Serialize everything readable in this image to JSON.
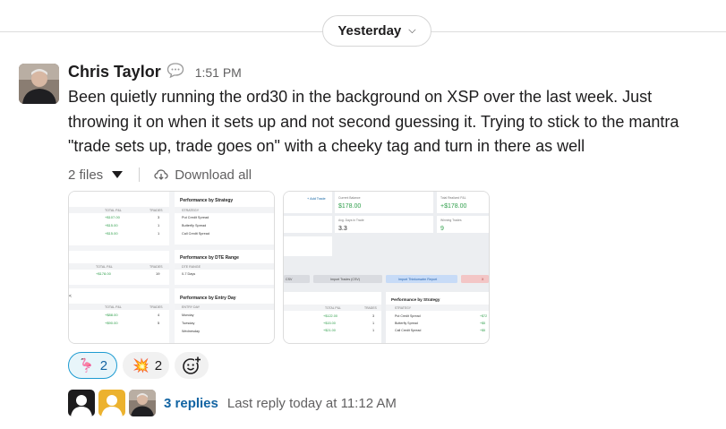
{
  "divider": {
    "date_label": "Yesterday"
  },
  "message": {
    "sender": "Chris Taylor",
    "time": "1:51 PM",
    "lines": [
      "Been quietly running the ord30 in the background on XSP over the last week. Just",
      "throwing it on when it sets up and not second guessing it. Trying to stick to the mantra",
      "\"trade sets up, trade goes on\" with a cheeky tag and turn in there as well"
    ]
  },
  "files": {
    "count_label": "2 files",
    "download_label": "Download all"
  },
  "thumb1": {
    "perf_strategy": "Performance by Strategy",
    "strategy_header": "STRATEGY",
    "strategies": [
      "Put Credit Spread",
      "Butterfly Spread",
      "Call Credit Spread"
    ],
    "left_header": [
      "TOTAL P&L",
      "TRADES"
    ],
    "left_rows": [
      [
        "+$107.00",
        "3"
      ],
      [
        "+$15.00",
        "1"
      ],
      [
        "+$15.00",
        "1"
      ]
    ],
    "perf_dte": "Performance by DTE Range",
    "dte_header": "DTE RANGE",
    "dte_rows": [
      "0-7 Days"
    ],
    "left2_header": [
      "TOTAL P&L",
      "TRADES"
    ],
    "left2_rows": [
      [
        "+$178.00",
        "19"
      ]
    ],
    "perf_day": "Performance by Entry Day",
    "day_header": "ENTRY DAY",
    "days": [
      "Monday",
      "Tuesday",
      "Wednesday"
    ],
    "left3_header": [
      "TOTAL P&L",
      "TRADES"
    ],
    "left3_rows": [
      [
        "+$88.00",
        "4"
      ],
      [
        "+$90.00",
        "5"
      ]
    ]
  },
  "thumb2": {
    "add_trade": "+ Add Trade",
    "stat1_label": "Current Balance",
    "stat1_value": "$178.00",
    "stat2_label": "Total Realized P&L",
    "stat2_value": "+$178.00",
    "stat3_label": "Avg. Days in Trade",
    "stat3_value": "3.3",
    "stat4_label": "Winning Trades",
    "stat4_value": "9",
    "btn_csv": "CSV",
    "btn_import": "Import Trades (CSV)",
    "btn_report": "Import Thinkorswim Report",
    "btn_x": "X",
    "perf_strategy": "Performance by Strategy",
    "strategy_header": "STRATEGY",
    "strategies": [
      "Put Credit Spread",
      "Butterfly Spread",
      "Call Credit Spread"
    ],
    "left_header": [
      "TOTAL P&L",
      "TRADES"
    ],
    "left_rows": [
      [
        "+$122.00",
        "3"
      ],
      [
        "+$15.00",
        "1"
      ],
      [
        "+$21.00",
        "1"
      ]
    ],
    "right_vals": [
      "+$72",
      "+$5",
      "+$5"
    ]
  },
  "reactions": [
    {
      "emoji": "🦩",
      "count": "2"
    },
    {
      "emoji": "💥",
      "count": "2"
    }
  ],
  "thread": {
    "replies": "3 replies",
    "last_reply": "Last reply today at 11:12 AM"
  },
  "colors": {
    "link": "#1264a3",
    "green": "#2e9e4a",
    "reaction_border": "#1d9bd1"
  }
}
